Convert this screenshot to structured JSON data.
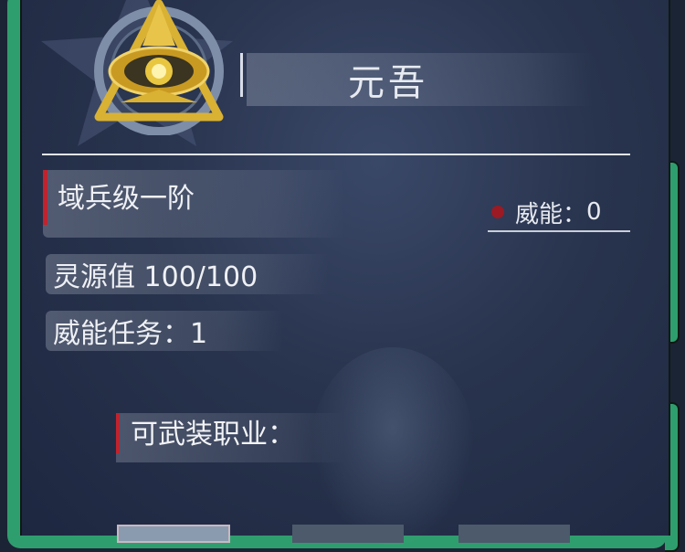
{
  "character": {
    "name": "元吾"
  },
  "stats": {
    "rank": "域兵级一阶",
    "power_label": "威能：",
    "power_value": "0",
    "spirit": "灵源值 100/100",
    "task": "威能任务：1"
  },
  "jobs": {
    "label": "可武装职业："
  },
  "colors": {
    "frame": "#2f9e6e",
    "accent_red": "#c0232e",
    "panel_bg": "#28334d",
    "emblem_gold": "#d9b133"
  }
}
